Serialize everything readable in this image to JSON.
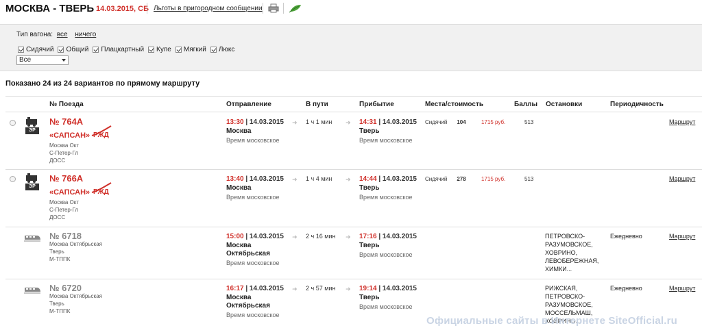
{
  "header": {
    "route_title": "МОСКВА - ТВЕРЬ",
    "date": "14.03.2015, СБ",
    "benefits_link": "Льготы в пригородном сообщении"
  },
  "filter": {
    "wagon_type_label": "Тип вагона:",
    "all_link": "все",
    "none_link": "ничего",
    "checkboxes": [
      {
        "label": "Сидячий",
        "checked": true
      },
      {
        "label": "Общий",
        "checked": true
      },
      {
        "label": "Плацкартный",
        "checked": true
      },
      {
        "label": "Купе",
        "checked": true
      },
      {
        "label": "Мягкий",
        "checked": true
      },
      {
        "label": "Люкс",
        "checked": true
      }
    ],
    "select_value": "Все"
  },
  "results_title": "Показано 24 из 24 вариантов по прямому маршруту",
  "columns": [
    "№ Поезда",
    "Отправление",
    "В пути",
    "Прибытие",
    "Места/стоимость",
    "Баллы",
    "Остановки",
    "Периодичность"
  ],
  "rows": [
    {
      "number": "№ 764А",
      "name": "«САПСАН»",
      "badge": "ЭР",
      "sub": [
        "Москва Окт",
        "С-Петер-Гл",
        "ДОСС"
      ],
      "dep_time": "13:30",
      "dep_date": "| 14.03.2015",
      "dep_station": [
        "Москва"
      ],
      "dep_tz": "Время московское",
      "duration": "1 ч 1 мин",
      "arr_time": "14:31",
      "arr_date": "| 14.03.2015",
      "arr_station": "Тверь",
      "arr_tz": "Время московское",
      "seat_type": "Сидячий",
      "seats": "104",
      "price": "1715 руб.",
      "points": "513",
      "stops": [],
      "period": "",
      "route_link": "Маршрут"
    },
    {
      "number": "№ 766А",
      "name": "«САПСАН»",
      "badge": "ЭР",
      "sub": [
        "Москва Окт",
        "С-Петер-Гл",
        "ДОСС"
      ],
      "dep_time": "13:40",
      "dep_date": "| 14.03.2015",
      "dep_station": [
        "Москва"
      ],
      "dep_tz": "Время московское",
      "duration": "1 ч 4 мин",
      "arr_time": "14:44",
      "arr_date": "| 14.03.2015",
      "arr_station": "Тверь",
      "arr_tz": "Время московское",
      "seat_type": "Сидячий",
      "seats": "278",
      "price": "1715 руб.",
      "points": "513",
      "stops": [],
      "period": "",
      "route_link": "Маршрут"
    },
    {
      "number": "№ 6718",
      "sub": [
        "Москва Октябрьская",
        "Тверь",
        "М-ТППК"
      ],
      "dep_time": "15:00",
      "dep_date": "| 14.03.2015",
      "dep_station": [
        "Москва",
        "Октябрьская"
      ],
      "dep_tz": "Время московское",
      "duration": "2 ч 16 мин",
      "arr_time": "17:16",
      "arr_date": "| 14.03.2015",
      "arr_station": "Тверь",
      "arr_tz": "Время московское",
      "stops": [
        "ПЕТРОВСКО-",
        "РАЗУМОВСКОЕ,",
        "ХОВРИНО,",
        "ЛЕВОБЕРЕЖНАЯ,",
        "ХИМКИ..."
      ],
      "period": "Ежедневно",
      "route_link": "Маршрут"
    },
    {
      "number": "№ 6720",
      "sub": [
        "Москва Октябрьская",
        "Тверь",
        "М-ТППК"
      ],
      "dep_time": "16:17",
      "dep_date": "| 14.03.2015",
      "dep_station": [
        "Москва",
        "Октябрьская"
      ],
      "dep_tz": "Время московское",
      "duration": "2 ч 57 мин",
      "arr_time": "19:14",
      "arr_date": "| 14.03.2015",
      "arr_station": "Тверь",
      "arr_tz": "Время московское",
      "stops": [
        "РИЖСКАЯ,",
        "ПЕТРОВСКО-",
        "РАЗУМОВСКОЕ,",
        "МОССЕЛЬМАШ,",
        "ХОВРИНО..."
      ],
      "period": "Ежедневно",
      "route_link": "Маршрут"
    }
  ],
  "watermark": "Официальные сайты в Интернете SiteOfficial.ru",
  "colors": {
    "accent": "#d0302a",
    "panel": "#f1f1f1"
  }
}
